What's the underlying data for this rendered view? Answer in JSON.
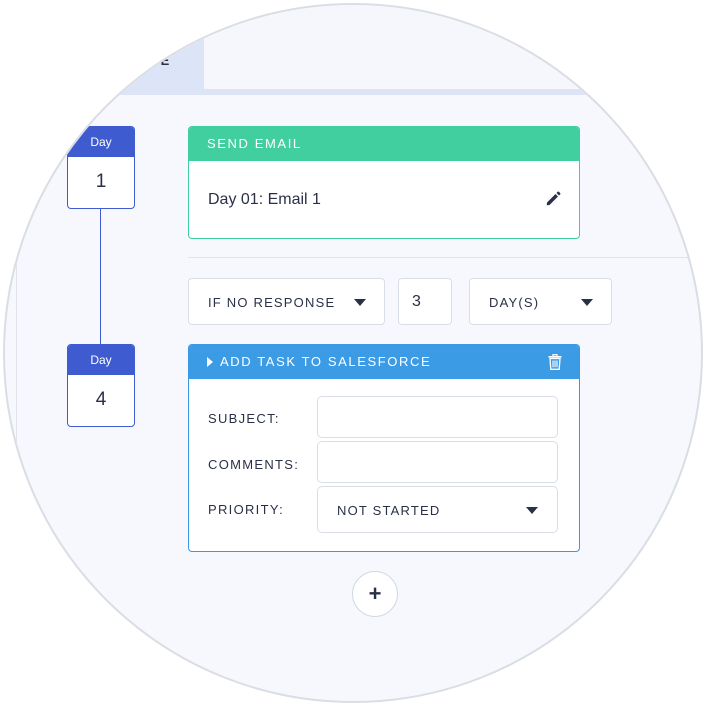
{
  "tabs": {
    "active_label_fragment": "CE"
  },
  "steps": [
    {
      "day_label": "Day",
      "day_number": "1"
    },
    {
      "day_label": "Day",
      "day_number": "4"
    }
  ],
  "send_email": {
    "header": "SEND EMAIL",
    "title": "Day 01: Email 1",
    "edit_icon": "pencil-icon"
  },
  "condition": {
    "trigger": "IF NO RESPONSE",
    "count": "3",
    "unit": "DAY(S)"
  },
  "salesforce_task": {
    "header": "ADD TASK TO SALESFORCE",
    "delete_icon": "trash-icon",
    "subject_label": "SUBJECT:",
    "subject_value": "",
    "comments_label": "COMMENTS:",
    "comments_value": "",
    "priority_label": "PRIORITY:",
    "priority_value": "NOT STARTED"
  },
  "add_step": {
    "label": "+"
  },
  "colors": {
    "day_badge": "#3f5bd0",
    "email_header": "#42cf9f",
    "salesforce_header": "#3b9be5"
  }
}
